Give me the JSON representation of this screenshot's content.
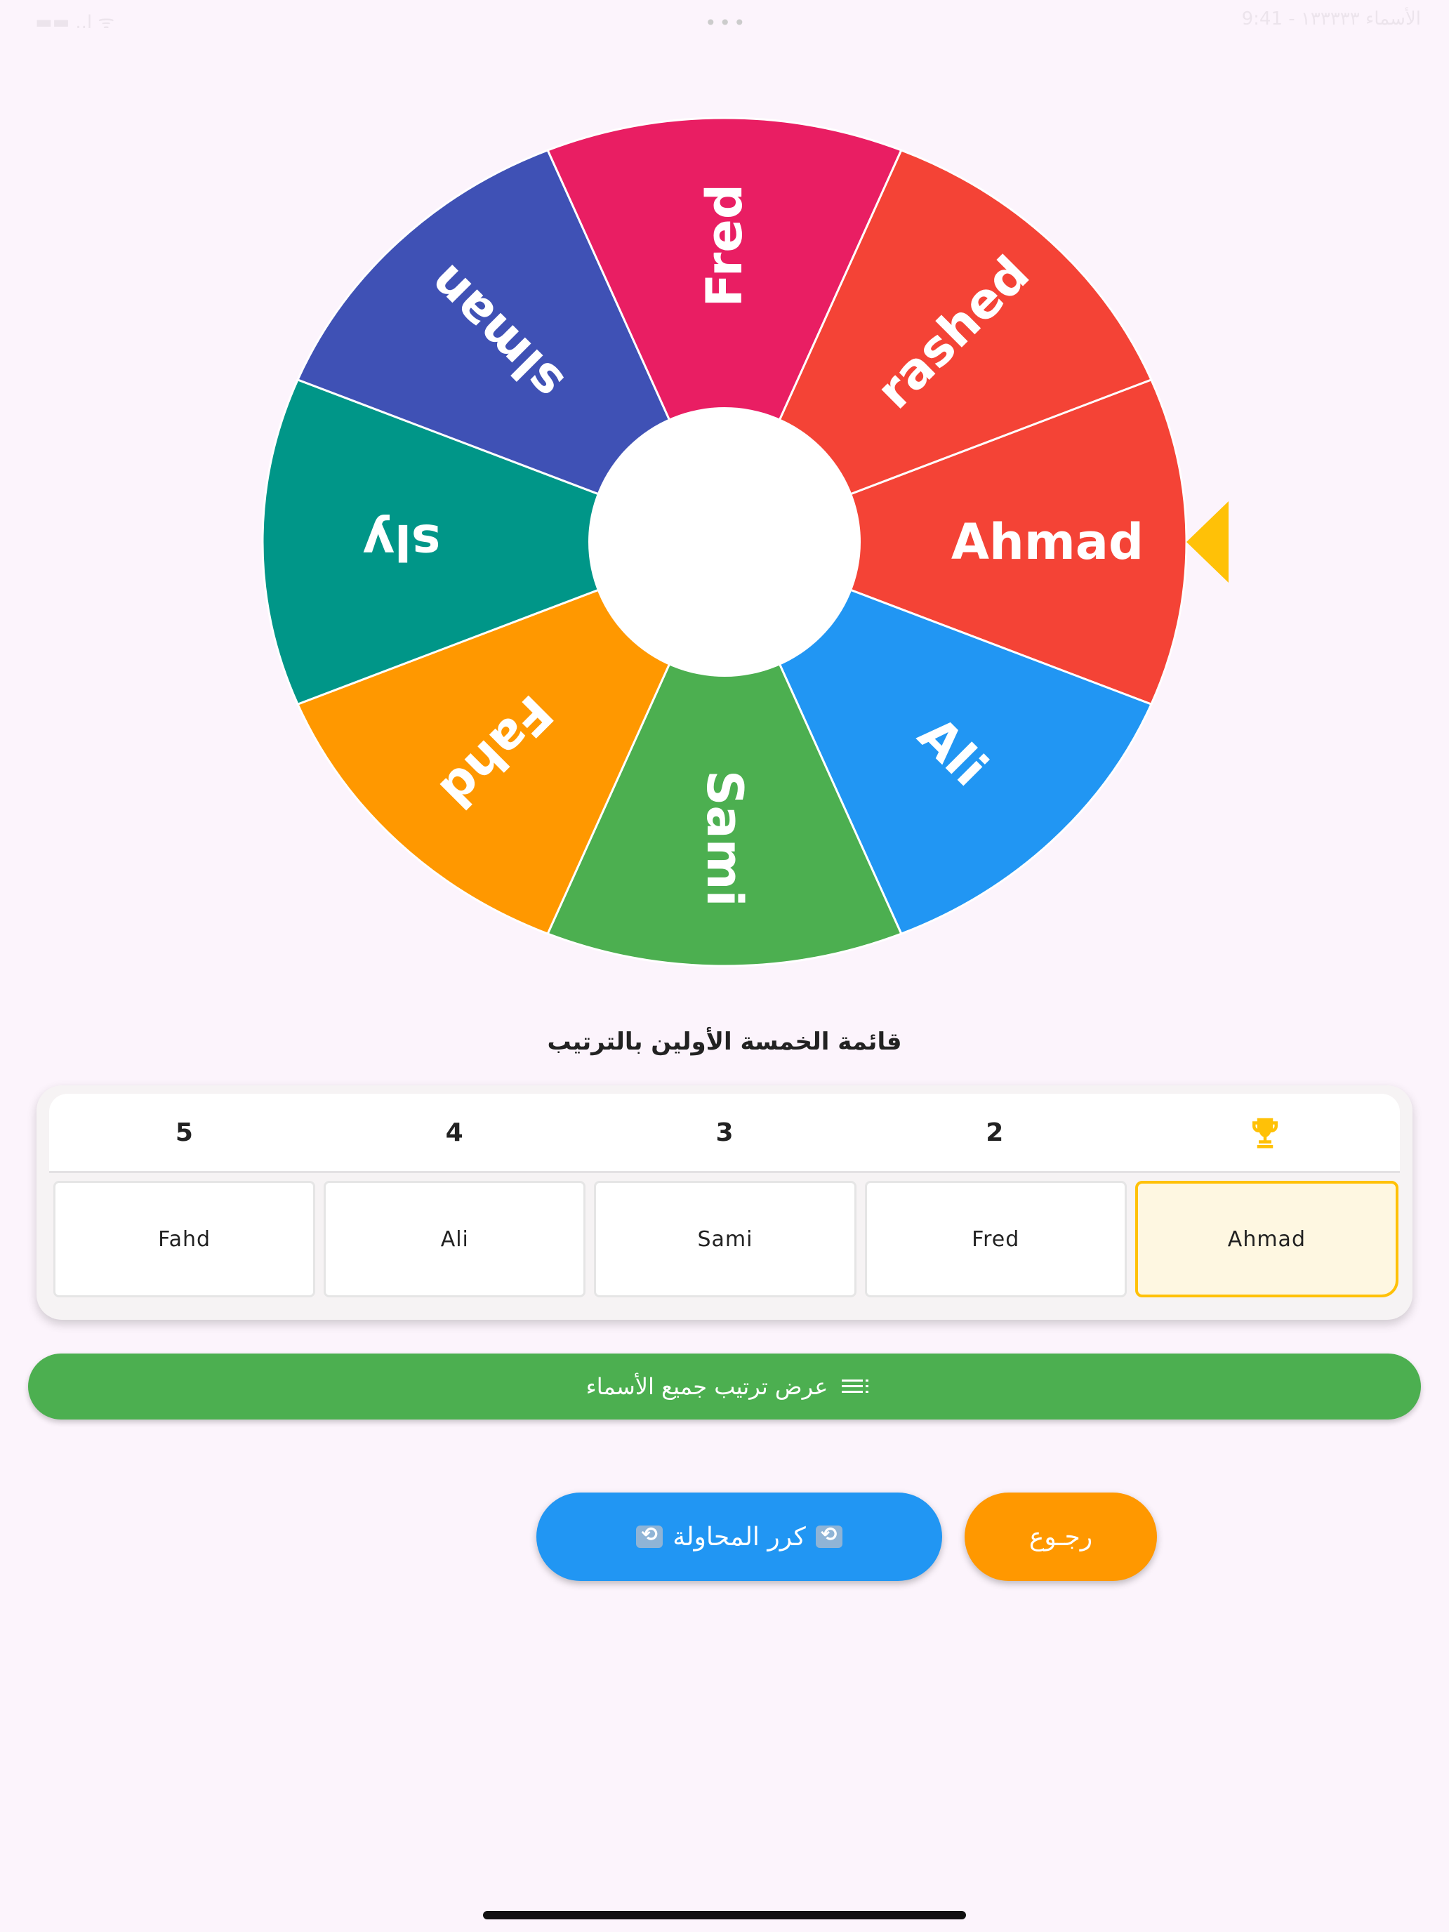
{
  "status_bar": {
    "left": "▬▬ ..l ᯤ",
    "right": "الأسماء ١٣٣٣٣٣ - 9:41"
  },
  "wheel": {
    "segments": [
      {
        "label": "Ahmad",
        "color": "#f44336"
      },
      {
        "label": "Ali",
        "color": "#2196f3"
      },
      {
        "label": "Sami",
        "color": "#4caf50"
      },
      {
        "label": "Fahd",
        "color": "#ff9800"
      },
      {
        "label": "sly",
        "color": "#009688"
      },
      {
        "label": "slman",
        "color": "#3f51b5"
      },
      {
        "label": "Fred",
        "color": "#e91e63"
      },
      {
        "label": "rashed",
        "color": "#f44336"
      }
    ],
    "pointer_color": "#ffc107"
  },
  "top5": {
    "title": "قائمة الخمسة الأولين بالترتيب",
    "ranks": [
      "🏆",
      "2",
      "3",
      "4",
      "5"
    ],
    "names": [
      "Ahmad",
      "Fred",
      "Sami",
      "Ali",
      "Fahd"
    ]
  },
  "show_all": {
    "label": "عرض ترتيب جميع الأسماء",
    "icon": "list-icon"
  },
  "retry": {
    "label": "كرر المحاولة",
    "icon": "repeat-icon"
  },
  "back": {
    "label": "رجـوع"
  },
  "colors": {
    "green": "#4caf50",
    "blue": "#2196f3",
    "orange": "#ff9800",
    "gold": "#ffc107"
  }
}
